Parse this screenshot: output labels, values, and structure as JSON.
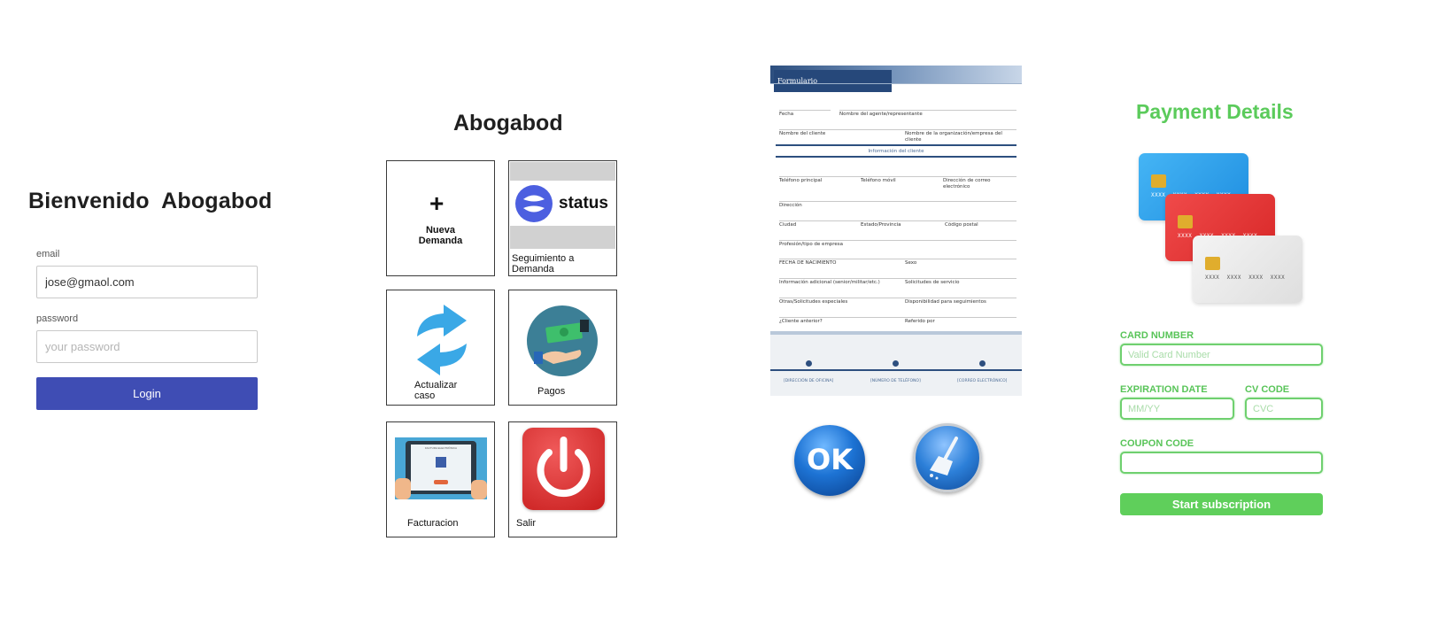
{
  "login": {
    "title": "Bienvenido  Abogabod",
    "email_label": "email",
    "email_value": "jose@gmaol.com",
    "password_label": "password",
    "password_placeholder": "your password",
    "login_button": "Login",
    "accent_color": "#3f4db4"
  },
  "menu": {
    "title": "Abogabod",
    "tiles": [
      {
        "label": "Nueva\nDemanda",
        "icon": "plus-icon"
      },
      {
        "label": "Seguimiento a\nDemanda",
        "icon": "status-logo",
        "logo_text": "status"
      },
      {
        "label": "Actualizar\ncaso",
        "icon": "refresh-icon"
      },
      {
        "label": "Pagos",
        "icon": "payment-icon"
      },
      {
        "label": "Facturacion",
        "icon": "invoice-tablet-icon",
        "tablet_text": "FACTURA ELECTRÓNICA"
      },
      {
        "label": "Salir",
        "icon": "power-icon"
      }
    ]
  },
  "form": {
    "header": "Formulario",
    "section_title": "Información del cliente",
    "fields": {
      "fecha": "Fecha",
      "agente": "Nombre del agente/representante",
      "cliente": "Nombre del cliente",
      "organizacion": "Nombre de la organización/empresa del cliente",
      "tel_principal": "Teléfono principal",
      "tel_movil": "Teléfono móvil",
      "correo": "Dirección de correo electrónico",
      "direccion": "Dirección",
      "ciudad": "Ciudad",
      "estado": "Estado/Provincia",
      "codigo": "Código postal",
      "profesion": "Profesión/tipo de empresa",
      "nacimiento": "FECHA DE NACIMIENTO",
      "sexo": "Sexo",
      "info_adicional": "Información adicional (senior/militar/etc.)",
      "solicitudes": "Solicitudes de servicio",
      "otras": "Otras/Solicitudes especiales",
      "disponibilidad": "Disponibilidad para seguimientos",
      "cliente_anterior": "¿Cliente anterior?",
      "referido": "Referido por"
    },
    "footer": {
      "oficina": "[DIRECCIÓN DE OFICINA]",
      "telefono": "[NÚMERO DE TELÉFONO]",
      "correo": "[CORREO ELECTRÓNICO]"
    },
    "ok_button": "OK",
    "clear_icon": "broom-icon"
  },
  "payment": {
    "title": "Payment Details",
    "card_number_label": "CARD NUMBER",
    "card_number_placeholder": "Valid Card Number",
    "expiration_label": "EXPIRATION DATE",
    "expiration_placeholder": "MM/YY",
    "cvc_label": "CV CODE",
    "cvc_placeholder": "CVC",
    "coupon_label": "COUPON CODE",
    "coupon_value": "",
    "subscribe_button": "Start subscription",
    "card_numbers": "XXXX  XXXX  XXXX  XXXX",
    "accent_color": "#5fcf5b"
  }
}
